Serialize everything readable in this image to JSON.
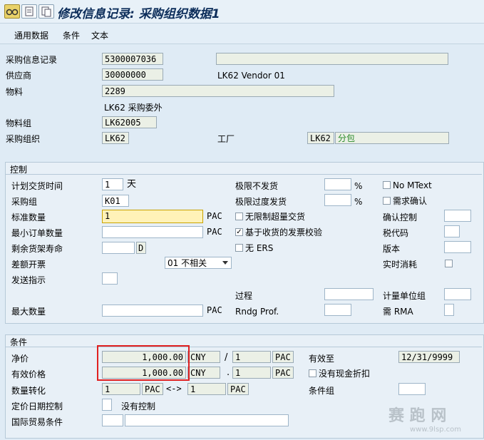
{
  "window": {
    "title": "修改信息记录: 采购组织数据1"
  },
  "toolbar_icons": [
    "glasses-icon",
    "document-icon",
    "document-alt-icon"
  ],
  "menu": [
    "通用数据",
    "条件",
    "文本"
  ],
  "header": {
    "info_record_label": "采购信息记录",
    "info_record_value": "5300007036",
    "vendor_label": "供应商",
    "vendor_value": "30000000",
    "vendor_name": "LK62 Vendor 01",
    "material_label": "物料",
    "material_value": "2289",
    "material_desc": "LK62 采购委外",
    "material_group_label": "物料组",
    "material_group_value": "LK62005",
    "purch_org_label": "采购组织",
    "purch_org_value": "LK62",
    "plant_label": "工厂",
    "plant_value": "LK62",
    "plant_desc": "分包"
  },
  "control": {
    "section_title": "控制",
    "planned_delivery_label": "计划交货时间",
    "planned_delivery_value": "1",
    "planned_delivery_unit": "天",
    "purch_group_label": "采购组",
    "purch_group_value": "K01",
    "std_qty_label": "标准数量",
    "std_qty_value": "1",
    "std_qty_unit": "PAC",
    "min_order_label": "最小订单数量",
    "min_order_value": "",
    "min_order_unit": "PAC",
    "shelf_life_label": "剩余货架寿命",
    "shelf_life_value": "",
    "shelf_life_unit": "D",
    "diff_invoice_label": "差额开票",
    "diff_invoice_value": "01 不相关",
    "ship_instr_label": "发送指示",
    "ship_instr_value": "",
    "max_qty_label": "最大数量",
    "max_qty_value": "",
    "max_qty_unit": "PAC",
    "under_tol_label": "极限不发货",
    "under_tol_value": "",
    "under_tol_unit": "%",
    "over_tol_label": "极限过度发货",
    "over_tol_value": "",
    "over_tol_unit": "%",
    "unlimited_label": "无限制超量交货",
    "unlimited_checked": false,
    "gr_based_label": "基于收货的发票校验",
    "gr_based_checked": true,
    "no_ers_label": "无 ERS",
    "no_ers_checked": false,
    "procedure_label": "过程",
    "procedure_value": "",
    "rndg_label": "Rndg Prof.",
    "rndg_value": "",
    "no_mtext_label": "No MText",
    "no_mtext_checked": false,
    "ack_req_label": "需求确认",
    "ack_req_checked": false,
    "conf_ctrl_label": "确认控制",
    "conf_ctrl_value": "",
    "tax_code_label": "税代码",
    "tax_code_value": "",
    "version_label": "版本",
    "version_value": "",
    "realtime_label": "实时消耗",
    "realtime_checked": false,
    "uom_group_label": "计量单位组",
    "uom_group_value": "",
    "rma_label": "需 RMA",
    "rma_value": ""
  },
  "conditions": {
    "section_title": "条件",
    "net_price_label": "净价",
    "net_price_value": "1,000.00",
    "net_price_curr": "CNY",
    "net_price_sep": "/",
    "net_price_per": "1",
    "net_price_unit": "PAC",
    "eff_price_label": "有效价格",
    "eff_price_value": "1,000.00",
    "eff_price_curr": "CNY",
    "eff_price_sep": ".",
    "eff_price_per": "1",
    "eff_price_unit": "PAC",
    "qty_conv_label": "数量转化",
    "qty_conv_from": "1",
    "qty_conv_from_unit": "PAC",
    "qty_conv_arrow": "<->",
    "qty_conv_to": "1",
    "qty_conv_to_unit": "PAC",
    "price_date_label": "定价日期控制",
    "price_date_value": "",
    "price_date_desc": "没有控制",
    "incoterms_label": "国际贸易条件",
    "incoterms_value1": "",
    "incoterms_value2": "",
    "valid_to_label": "有效至",
    "valid_to_value": "12/31/9999",
    "no_cash_disc_label": "没有现金折扣",
    "no_cash_disc_checked": false,
    "cond_group_label": "条件组",
    "cond_group_value": ""
  },
  "watermark": {
    "text": "赛 跑 网",
    "url": "www.9lsp.com"
  }
}
